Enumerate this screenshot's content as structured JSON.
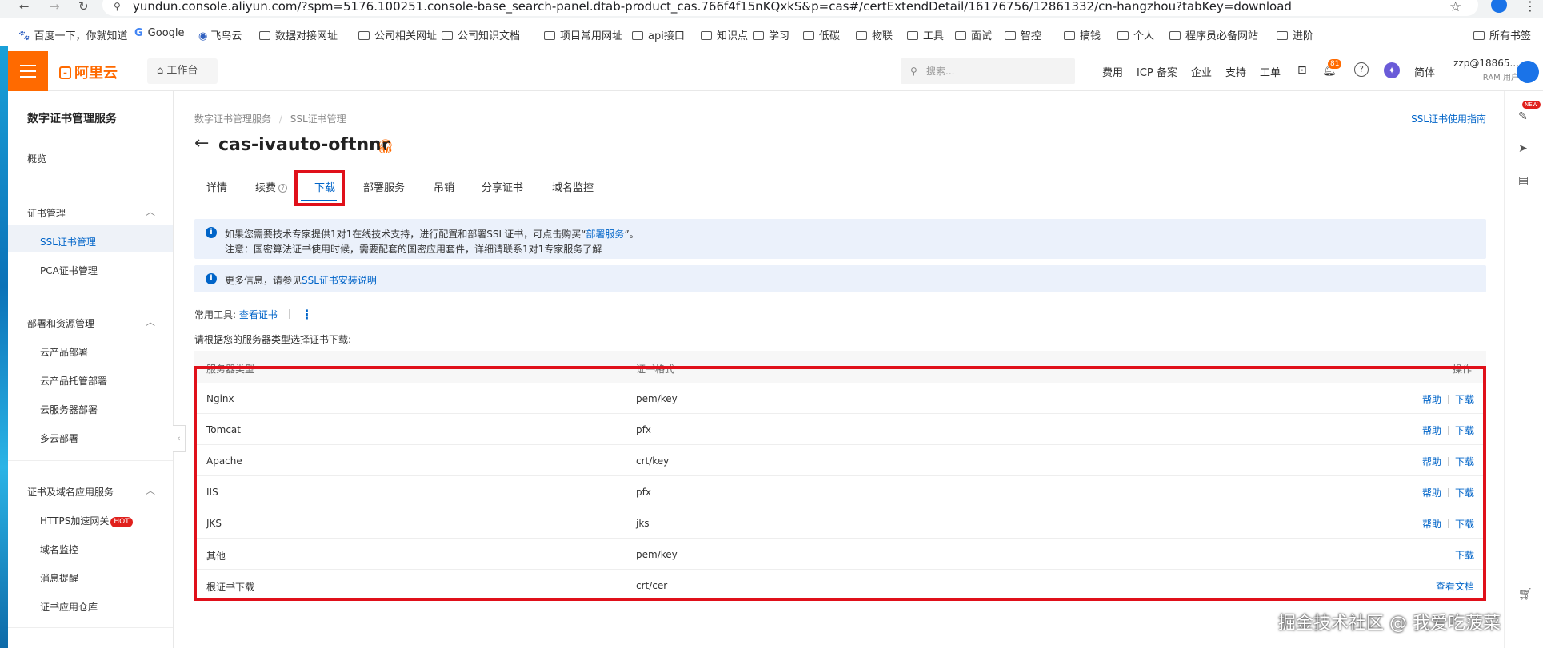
{
  "browser": {
    "url": "yundun.console.aliyun.com/?spm=5176.100251.console-base_search-panel.dtab-product_cas.766f4f15nKQxkS&p=cas#/certExtendDetail/16176756/12861332/cn-hangzhou?tabKey=download",
    "bookmarks": [
      {
        "label": "百度一下，你就知道",
        "icon": "baidu-icon"
      },
      {
        "label": "Google",
        "icon": "google-icon"
      },
      {
        "label": "飞鸟云",
        "icon": "globe-icon"
      },
      {
        "label": "数据对接网址",
        "icon": "folder-icon"
      },
      {
        "label": "公司相关网址",
        "icon": "folder-icon"
      },
      {
        "label": "公司知识文档",
        "icon": "folder-icon"
      },
      {
        "label": "项目常用网址",
        "icon": "folder-icon"
      },
      {
        "label": "api接口",
        "icon": "folder-icon"
      },
      {
        "label": "知识点",
        "icon": "folder-icon"
      },
      {
        "label": "学习",
        "icon": "folder-icon"
      },
      {
        "label": "低碳",
        "icon": "folder-icon"
      },
      {
        "label": "物联",
        "icon": "folder-icon"
      },
      {
        "label": "工具",
        "icon": "folder-icon"
      },
      {
        "label": "面试",
        "icon": "folder-icon"
      },
      {
        "label": "智控",
        "icon": "folder-icon"
      },
      {
        "label": "搞钱",
        "icon": "folder-icon"
      },
      {
        "label": "个人",
        "icon": "folder-icon"
      },
      {
        "label": "程序员必备网站",
        "icon": "folder-icon"
      },
      {
        "label": "进阶",
        "icon": "folder-icon"
      }
    ],
    "all_bookmarks": "所有书签"
  },
  "topnav": {
    "logo": "阿里云",
    "workbench": "工作台",
    "search_placeholder": "搜索...",
    "links": [
      "费用",
      "ICP 备案",
      "企业",
      "支持",
      "工单"
    ],
    "notification_count": "81",
    "lang": "简体",
    "user_name": "zzp@18865...",
    "user_role": "RAM 用户"
  },
  "sidebar": {
    "title": "数字证书管理服务",
    "overview": "概览",
    "groups": [
      {
        "label": "证书管理",
        "items": [
          "SSL证书管理",
          "PCA证书管理"
        ]
      },
      {
        "label": "部署和资源管理",
        "items": [
          "云产品部署",
          "云产品托管部署",
          "云服务器部署",
          "多云部署"
        ]
      },
      {
        "label": "证书及域名应用服务",
        "items": [
          "HTTPS加速网关",
          "域名监控",
          "消息提醒",
          "证书应用仓库"
        ]
      }
    ],
    "hot_badge": "HOT"
  },
  "rightbar": {
    "new_badge": "NEW"
  },
  "content": {
    "breadcrumb": [
      "数字证书管理服务",
      "SSL证书管理"
    ],
    "guide_link": "SSL证书使用指南",
    "title": "cas-ivauto-oftnnr",
    "tabs": [
      "详情",
      "续费",
      "下载",
      "部署服务",
      "吊销",
      "分享证书",
      "域名监控"
    ],
    "active_tab": "下载",
    "notice1": {
      "line1_prefix": "如果您需要技术专家提供1对1在线技术支持，进行配置和部署SSL证书，可点击购买“",
      "line1_link": "部署服务",
      "line1_suffix": "”。",
      "line2": "注意：国密算法证书使用时候，需要配套的国密应用套件，详细请联系1对1专家服务了解"
    },
    "notice2": {
      "prefix": "更多信息，请参见",
      "link": "SSL证书安装说明"
    },
    "tools_label": "常用工具:",
    "tools_link": "查看证书",
    "choose_text": "请根据您的服务器类型选择证书下载:",
    "table": {
      "headers": [
        "服务器类型",
        "证书格式",
        "操作"
      ],
      "rows": [
        {
          "server": "Nginx",
          "format": "pem/key",
          "help": "帮助",
          "action": "下载"
        },
        {
          "server": "Tomcat",
          "format": "pfx",
          "help": "帮助",
          "action": "下载"
        },
        {
          "server": "Apache",
          "format": "crt/key",
          "help": "帮助",
          "action": "下载"
        },
        {
          "server": "IIS",
          "format": "pfx",
          "help": "帮助",
          "action": "下载"
        },
        {
          "server": "JKS",
          "format": "jks",
          "help": "帮助",
          "action": "下载"
        },
        {
          "server": "其他",
          "format": "pem/key",
          "help": "",
          "action": "下载"
        },
        {
          "server": "根证书下载",
          "format": "crt/cer",
          "help": "",
          "action": "查看文档"
        }
      ]
    }
  },
  "watermark": "掘金技术社区 @ 我爱吃菠菜"
}
